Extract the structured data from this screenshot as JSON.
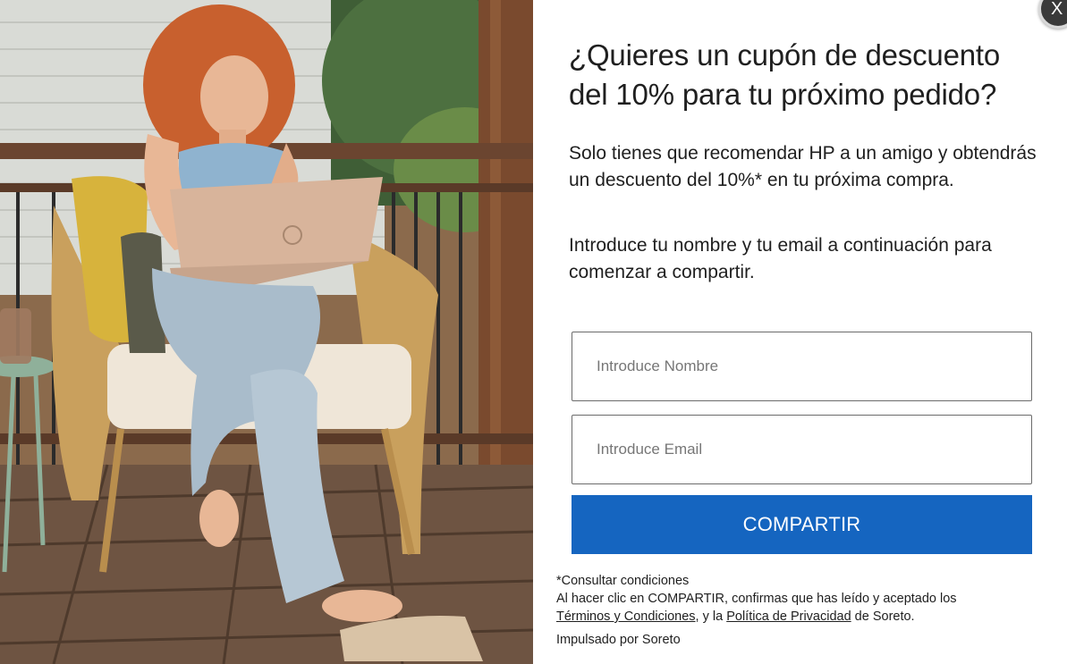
{
  "close": {
    "label": "X"
  },
  "headline": "¿Quieres un cupón de descuento del 10% para tu próximo pedido?",
  "paragraphs": {
    "p1": "Solo tienes que recomendar HP a un amigo y obtendrás un descuento del 10%* en tu próxima compra.",
    "p2": "Introduce tu nombre y tu email a continuación para comenzar a compartir."
  },
  "form": {
    "name_placeholder": "Introduce Nombre",
    "email_placeholder": "Introduce Email",
    "submit_label": "COMPARTIR"
  },
  "legal": {
    "note": "*Consultar condiciones",
    "consent_prefix": "Al hacer clic en COMPARTIR, confirmas que has leído y aceptado los",
    "terms_link": "Términos y Condiciones",
    "connector": ", y la",
    "privacy_link": "Política de Privacidad",
    "suffix": "de Soreto."
  },
  "powered_by": "Impulsado por Soreto",
  "colors": {
    "accent": "#1565c0",
    "close_bg": "#3a3a3a"
  }
}
